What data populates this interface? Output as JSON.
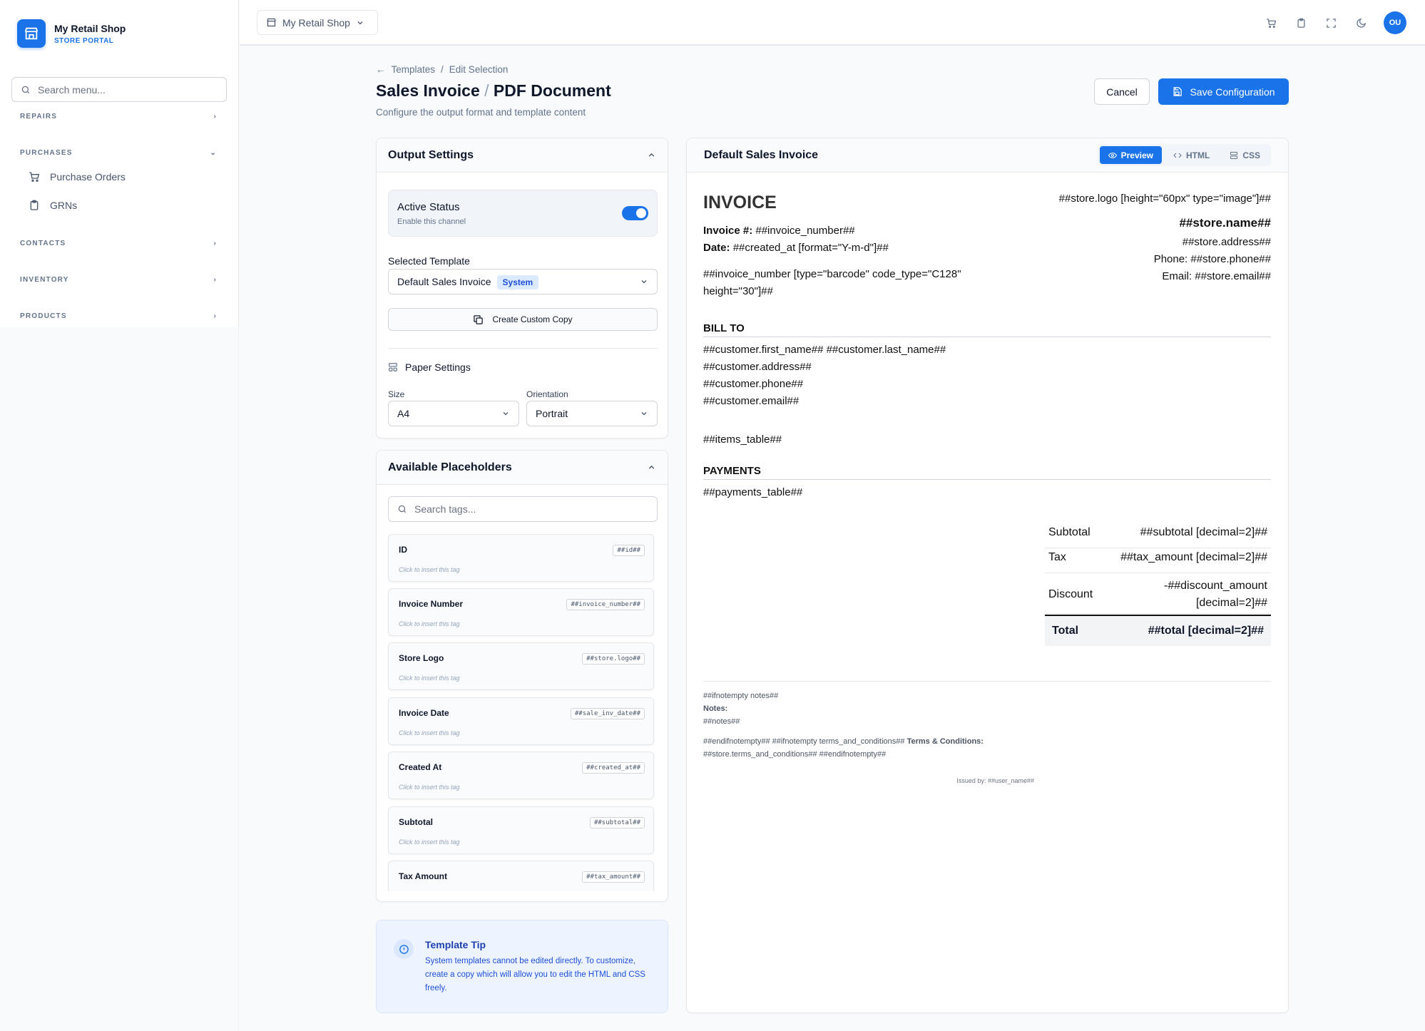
{
  "brand": {
    "name": "My Retail Shop",
    "subtitle": "STORE PORTAL"
  },
  "sidebar": {
    "search_placeholder": "Search menu...",
    "sections": [
      {
        "label": "REPAIRS"
      },
      {
        "label": "PURCHASES"
      },
      {
        "label": "CONTACTS"
      },
      {
        "label": "INVENTORY"
      },
      {
        "label": "PRODUCTS"
      }
    ],
    "purchase_items": [
      {
        "label": "Purchase Orders",
        "icon": "cart-icon"
      },
      {
        "label": "GRNs",
        "icon": "clipboard-icon"
      }
    ]
  },
  "topbar": {
    "shop": "My Retail Shop",
    "avatar": "OU"
  },
  "header": {
    "crumb_parent": "Templates",
    "crumb_sep": "/",
    "crumb_current": "Edit Selection",
    "title_main": "Sales Invoice",
    "title_sep": "/",
    "title_sub": "PDF Document",
    "subtitle": "Configure the output format and template content",
    "cancel": "Cancel",
    "save": "Save Configuration"
  },
  "output_settings": {
    "title": "Output Settings",
    "active_label": "Active Status",
    "active_desc": "Enable this channel",
    "active": true,
    "template_label": "Selected Template",
    "template_value": "Default Sales Invoice",
    "template_badge": "System",
    "copy_button": "Create Custom Copy",
    "paper_title": "Paper Settings",
    "size_label": "Size",
    "size_value": "A4",
    "orientation_label": "Orientation",
    "orientation_value": "Portrait"
  },
  "placeholders": {
    "title": "Available Placeholders",
    "search_placeholder": "Search tags...",
    "hint": "Click to insert this tag",
    "items": [
      {
        "name": "ID",
        "tag": "##id##"
      },
      {
        "name": "Invoice Number",
        "tag": "##invoice_number##"
      },
      {
        "name": "Store Logo",
        "tag": "##store.logo##"
      },
      {
        "name": "Invoice Date",
        "tag": "##sale_inv_date##"
      },
      {
        "name": "Created At",
        "tag": "##created_at##"
      },
      {
        "name": "Subtotal",
        "tag": "##subtotal##"
      },
      {
        "name": "Tax Amount",
        "tag": "##tax_amount##"
      }
    ]
  },
  "tip": {
    "title": "Template Tip",
    "body": "System templates cannot be edited directly. To customize, create a copy which will allow you to edit the HTML and CSS freely."
  },
  "preview": {
    "title": "Default Sales Invoice",
    "tabs": [
      "Preview",
      "HTML",
      "CSS"
    ],
    "doc": {
      "heading": "INVOICE",
      "inv_label": "Invoice #:",
      "inv_value": "##invoice_number##",
      "date_label": "Date:",
      "date_value": "##created_at [format=\"Y-m-d\"]##",
      "barcode": "##invoice_number [type=\"barcode\" code_type=\"C128\" height=\"30\"]##",
      "store_logo": "##store.logo [height=\"60px\" type=\"image\"]##",
      "store_name": "##store.name##",
      "store_address": "##store.address##",
      "store_phone": "Phone: ##store.phone##",
      "store_email": "Email: ##store.email##",
      "bill_to": "BILL TO",
      "customer": [
        "##customer.first_name## ##customer.last_name##",
        "##customer.address##",
        "##customer.phone##",
        "##customer.email##"
      ],
      "items_table": "##items_table##",
      "payments": "PAYMENTS",
      "payments_table": "##payments_table##",
      "totals": {
        "subtotal_label": "Subtotal",
        "subtotal_value": "##subtotal [decimal=2]##",
        "tax_label": "Tax",
        "tax_value": "##tax_amount [decimal=2]##",
        "discount_label": "Discount",
        "discount_value_1": "-##discount_amount",
        "discount_value_2": "[decimal=2]##",
        "total_label": "Total",
        "total_value": "##total [decimal=2]##"
      },
      "notes_1": "##ifnotempty notes##",
      "notes_label": "Notes:",
      "notes_value": "##notes##",
      "terms_1": "##endifnotempty## ##ifnotempty terms_and_conditions##",
      "terms_label": "Terms & Conditions:",
      "terms_2": "##store.terms_and_conditions## ##endifnotempty##",
      "issued_by": "Issued by: ##user_name##"
    }
  },
  "colors": {
    "accent": "#1a73e8"
  }
}
